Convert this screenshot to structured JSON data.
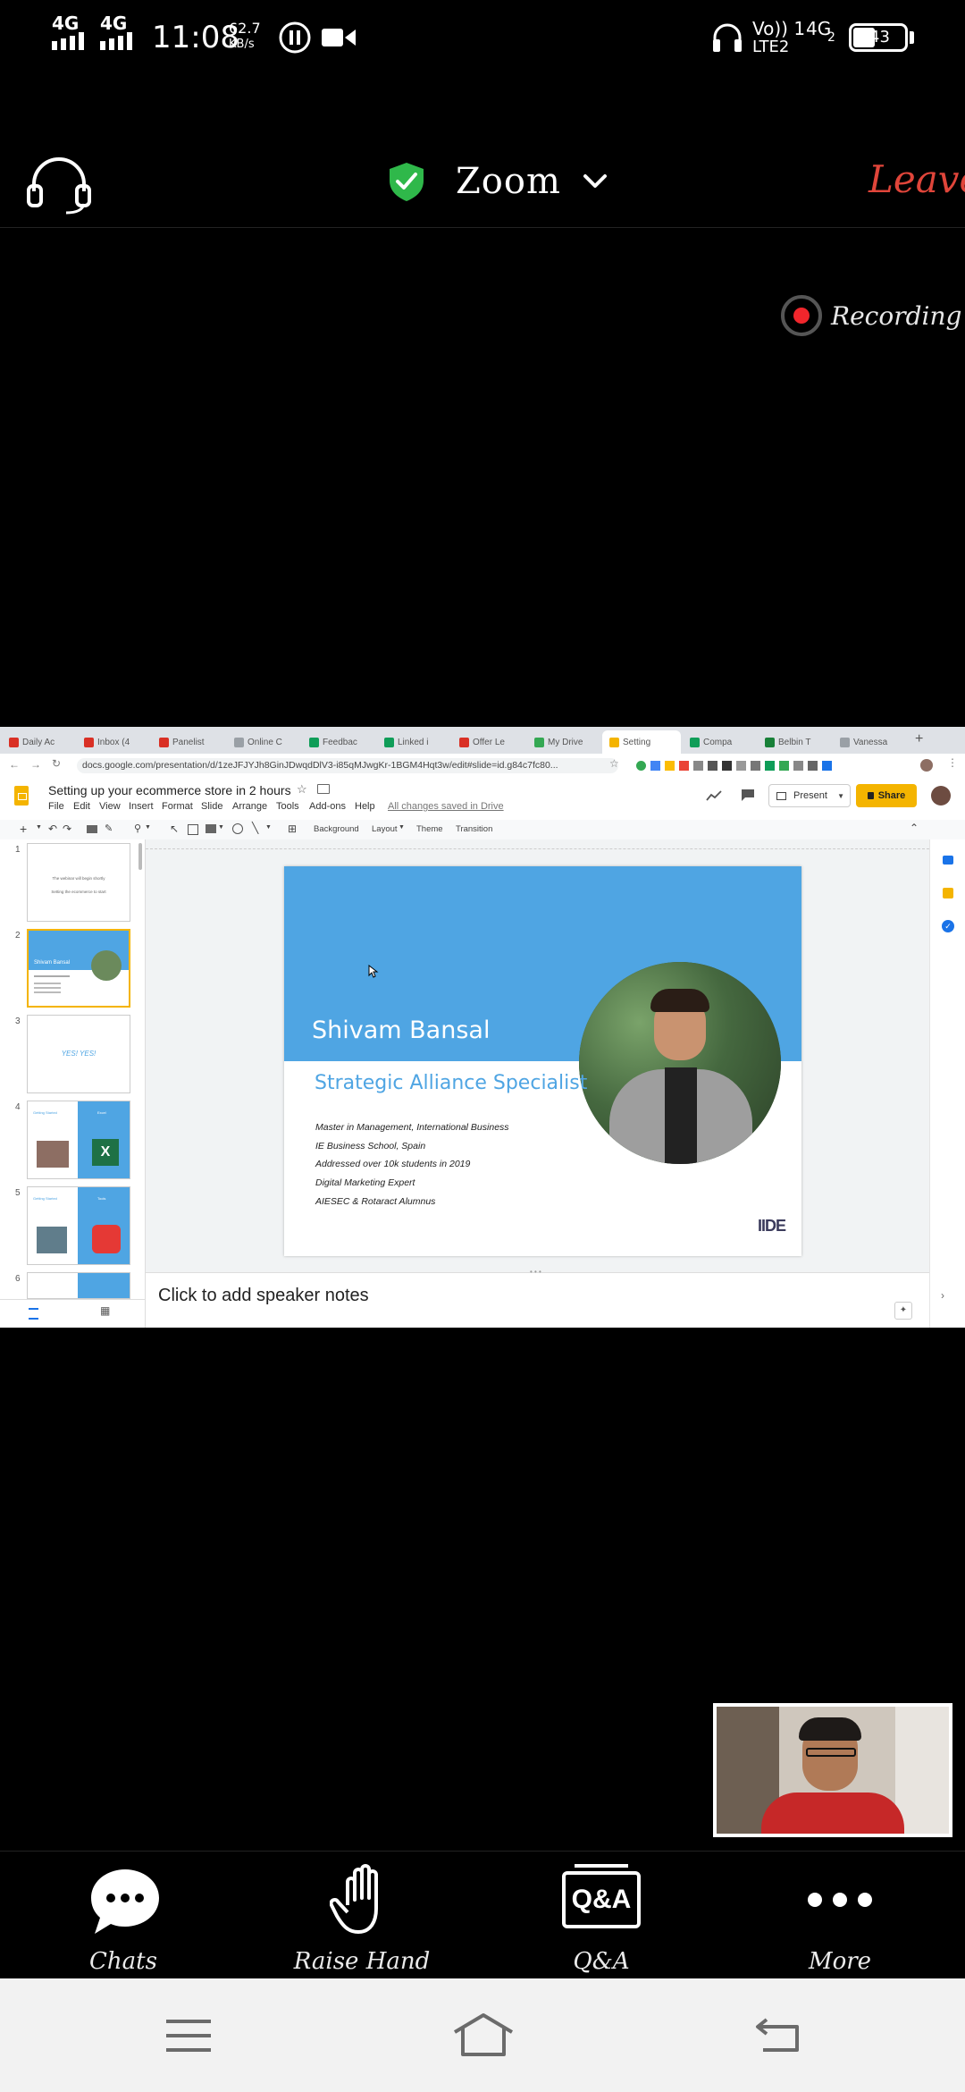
{
  "status_bar": {
    "net1": "4G",
    "net2": "4G",
    "time": "11:08",
    "speed_value": "62.7",
    "speed_unit": "KB/s",
    "volte": "Vo)) 1",
    "lte": "LTE2",
    "net3": "4G",
    "net3_sub": "2",
    "battery": "43"
  },
  "zoom_header": {
    "title": "Zoom",
    "leave_label": "Leave",
    "recording_label": "Recording"
  },
  "browser": {
    "tabs": [
      {
        "label": "Daily Ac",
        "favicon_color": "#d93025"
      },
      {
        "label": "Inbox (4",
        "favicon_color": "#d93025"
      },
      {
        "label": "Panelist",
        "favicon_color": "#d93025"
      },
      {
        "label": "Online C",
        "favicon_color": "#9aa0a6"
      },
      {
        "label": "Feedbac",
        "favicon_color": "#0f9d58"
      },
      {
        "label": "Linked i",
        "favicon_color": "#0f9d58"
      },
      {
        "label": "Offer Le",
        "favicon_color": "#d93025"
      },
      {
        "label": "My Drive",
        "favicon_color": "#34a853"
      },
      {
        "label": "Setting",
        "favicon_color": "#f4b400"
      },
      {
        "label": "Compa",
        "favicon_color": "#0f9d58"
      },
      {
        "label": "Belbin T",
        "favicon_color": "#188038"
      },
      {
        "label": "Vanessa",
        "favicon_color": "#9aa0a6"
      }
    ],
    "url": "docs.google.com/presentation/d/1zeJFJYJh8GinJDwqdDlV3-i85qMJwgKr-1BGM4Hqt3w/edit#slide=id.g84c7fc80..."
  },
  "slides_app": {
    "doc_title": "Setting up your ecommerce store in 2 hours",
    "menu": [
      "File",
      "Edit",
      "View",
      "Insert",
      "Format",
      "Slide",
      "Arrange",
      "Tools",
      "Add-ons",
      "Help"
    ],
    "save_status": "All changes saved in Drive",
    "present_label": "Present",
    "share_label": "Share",
    "toolbar": {
      "background": "Background",
      "layout": "Layout",
      "theme": "Theme",
      "transition": "Transition"
    },
    "thumbnails": [
      {
        "num": "1",
        "line1": "The webinar will begin shortly",
        "line2": "Setting the ecommerce to start"
      },
      {
        "num": "2",
        "name": "Shivam Bansal"
      },
      {
        "num": "3",
        "text": "YES! YES!"
      },
      {
        "num": "4",
        "label": "Getting Started",
        "side": "Excel"
      },
      {
        "num": "5",
        "label": "Getting Started",
        "side": "Tools"
      },
      {
        "num": "6"
      }
    ],
    "slide": {
      "name": "Shivam Bansal",
      "role": "Strategic Alliance Specialist",
      "bullets": [
        "Master in Management, International Business",
        "IE Business School, Spain",
        "Addressed over 10k students in 2019",
        "Digital Marketing Expert",
        "AIESEC & Rotaract Alumnus"
      ],
      "logo": "IIDE",
      "header_color": "#4fa5e3"
    },
    "notes_placeholder": "Click to add speaker notes"
  },
  "bottom_bar": {
    "chats_label": "Chats",
    "raise_hand_label": "Raise Hand",
    "qa_label": "Q&A",
    "qa_icon_text": "Q&A",
    "more_label": "More"
  },
  "colors": {
    "leave": "#e0453a",
    "shield": "#2fb84a",
    "recording_dot": "#f1262c"
  }
}
